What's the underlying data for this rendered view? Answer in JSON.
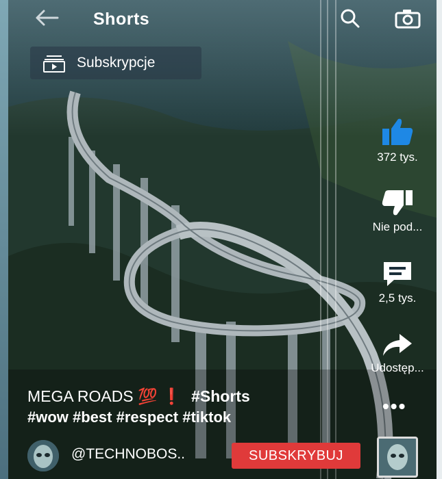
{
  "header": {
    "title": "Shorts"
  },
  "subscriptions": {
    "label": "Subskrypcje"
  },
  "actions": {
    "like_count": "372 tys.",
    "dislike_label": "Nie pod...",
    "comment_count": "2,5 tys.",
    "share_label": "Udostęp..."
  },
  "caption": {
    "line1_text": "MEGA ROADS",
    "line1_emoji": "💯",
    "line1_exclaim": "❗",
    "line1_hashtag": "#Shorts",
    "line2": "#wow #best #respect #tiktok"
  },
  "channel": {
    "handle": "@TECHNOBOS..",
    "subscribe_label": "SUBSKRYBUJ"
  },
  "more_label": "•••",
  "colors": {
    "subscribe": "#e03a3a",
    "like": "#1e88e5",
    "text": "#ffffff"
  }
}
